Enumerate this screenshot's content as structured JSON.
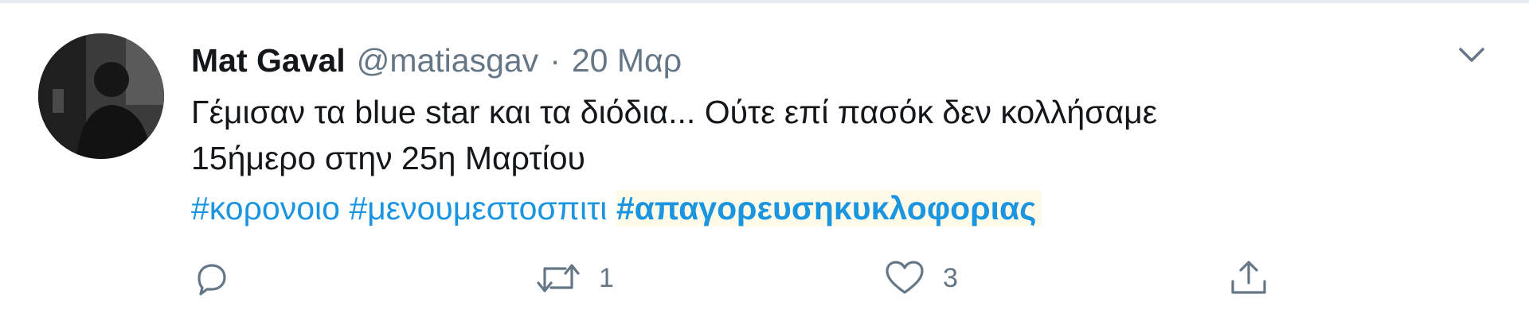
{
  "tweet": {
    "author": {
      "name": "Mat Gaval",
      "handle": "@matiasgav"
    },
    "separator": "·",
    "date": "20 Μαρ",
    "text_line1": "Γέμισαν τα blue star και τα διόδια... Ούτε επί πασόκ δεν κολλήσαμε",
    "text_line2": "15ήμερο στην 25η Μαρτίου",
    "hashtags": [
      "#κορονοιο",
      "#μενουμεστοσπιτι",
      "#απαγορευσηκυκλοφοριας"
    ],
    "actions": {
      "reply_icon": "reply-icon",
      "retweet_icon": "retweet-icon",
      "retweet_count": "1",
      "like_icon": "heart-icon",
      "like_count": "3",
      "share_icon": "share-icon"
    },
    "colors": {
      "link": "#1b95e0",
      "secondary": "#657786",
      "text": "#14171a"
    }
  }
}
